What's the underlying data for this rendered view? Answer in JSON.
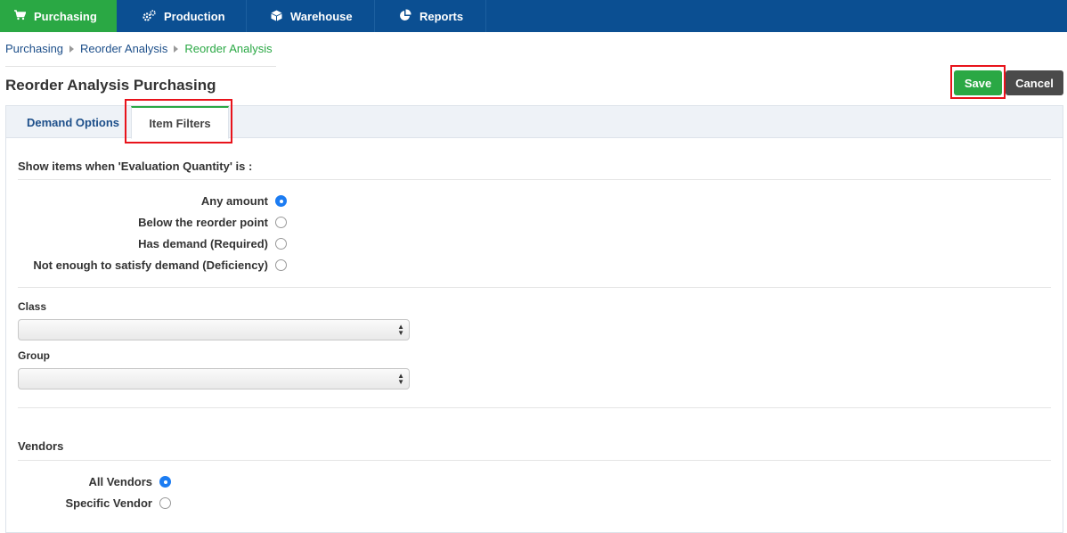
{
  "nav": {
    "items": [
      {
        "label": "Purchasing",
        "icon": "cart-icon",
        "active": true
      },
      {
        "label": "Production",
        "icon": "gears-icon",
        "active": false
      },
      {
        "label": "Warehouse",
        "icon": "box-icon",
        "active": false
      },
      {
        "label": "Reports",
        "icon": "pie-chart-icon",
        "active": false
      }
    ]
  },
  "breadcrumb": [
    "Purchasing",
    "Reorder Analysis",
    "Reorder Analysis"
  ],
  "page": {
    "title": "Reorder Analysis Purchasing"
  },
  "buttons": {
    "save": "Save",
    "cancel": "Cancel"
  },
  "tabs": [
    {
      "label": "Demand Options",
      "active": false
    },
    {
      "label": "Item Filters",
      "active": true
    }
  ],
  "evaluation": {
    "heading": "Show items when 'Evaluation Quantity' is :",
    "options": [
      {
        "label": "Any amount",
        "checked": true
      },
      {
        "label": "Below the reorder point",
        "checked": false
      },
      {
        "label": "Has demand (Required)",
        "checked": false
      },
      {
        "label": "Not enough to satisfy demand (Deficiency)",
        "checked": false
      }
    ]
  },
  "filters": {
    "class_label": "Class",
    "class_value": "",
    "group_label": "Group",
    "group_value": ""
  },
  "vendors": {
    "heading": "Vendors",
    "options": [
      {
        "label": "All Vendors",
        "checked": true
      },
      {
        "label": "Specific Vendor",
        "checked": false
      }
    ]
  },
  "colors": {
    "nav_bg": "#0b4f92",
    "accent_green": "#2aa844",
    "link_blue": "#1d4f8a",
    "highlight_red": "#e8131b"
  }
}
